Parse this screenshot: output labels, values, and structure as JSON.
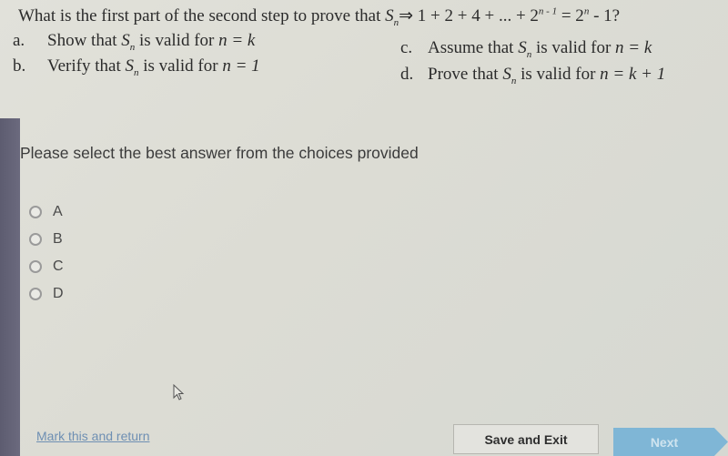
{
  "question": {
    "text_prefix": "What is the first part of the second step to prove that ",
    "formula": {
      "S": "S",
      "S_sub": "n",
      "arrow": "⇒",
      "series": " 1 + 2 + 4 + ... + 2",
      "exp1": "n - 1",
      "eq": " = 2",
      "exp2": "n",
      "tail": " - 1?"
    }
  },
  "options": [
    {
      "letter": "a.",
      "pre": "Show that ",
      "sub": "n",
      "post": " is valid for ",
      "cond": "n = k"
    },
    {
      "letter": "b.",
      "pre": "Verify that ",
      "sub": "n",
      "post": " is valid for ",
      "cond": "n = 1"
    },
    {
      "letter": "c.",
      "pre": "Assume that ",
      "sub": "n",
      "post": " is valid for ",
      "cond": "n = k"
    },
    {
      "letter": "d.",
      "pre": "Prove that ",
      "sub": "n",
      "post": " is valid for ",
      "cond": "n = k + 1"
    }
  ],
  "instruction": "Please select the best answer from the choices provided",
  "choices": [
    {
      "label": "A",
      "selected": false
    },
    {
      "label": "B",
      "selected": false
    },
    {
      "label": "C",
      "selected": false
    },
    {
      "label": "D",
      "selected": false
    }
  ],
  "footer": {
    "mark_link": "Mark this and return",
    "save_label": "Save and Exit",
    "next_label": "Next"
  },
  "colors": {
    "link": "#6e8fb3",
    "next_button": "#7fb6d6"
  }
}
